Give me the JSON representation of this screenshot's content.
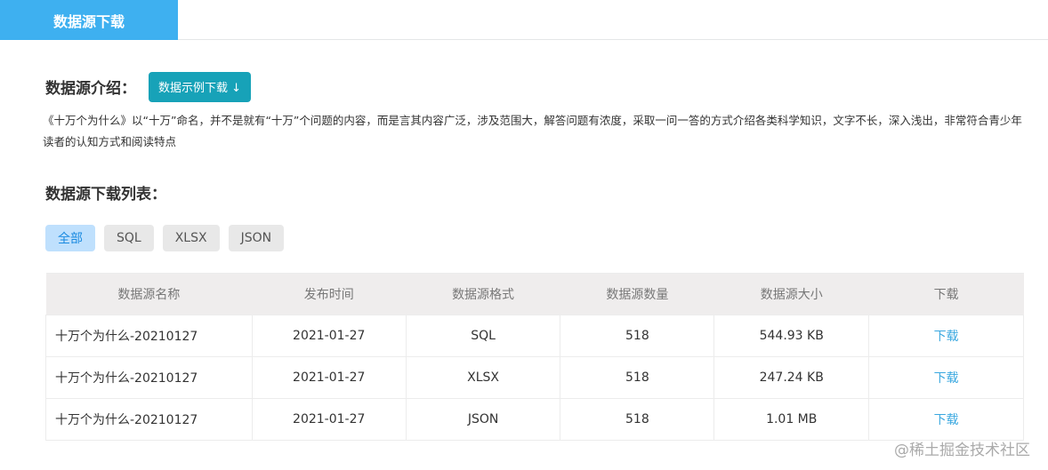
{
  "header": {
    "tab": "数据源下载"
  },
  "intro": {
    "title": "数据源介绍：",
    "download_sample": "数据示例下载 ↓",
    "description": "《十万个为什么》以“十万”命名，并不是就有“十万”个问题的内容，而是言其内容广泛，涉及范围大，解答问题有浓度，采取一问一答的方式介绍各类科学知识，文字不长，深入浅出，非常符合青少年读者的认知方式和阅读特点"
  },
  "list": {
    "title": "数据源下载列表：",
    "filters": [
      "全部",
      "SQL",
      "XLSX",
      "JSON"
    ],
    "columns": [
      "数据源名称",
      "发布时间",
      "数据源格式",
      "数据源数量",
      "数据源大小",
      "下载"
    ],
    "rows": [
      [
        "十万个为什么-20210127",
        "2021-01-27",
        "SQL",
        "518",
        "544.93 KB",
        "下载"
      ],
      [
        "十万个为什么-20210127",
        "2021-01-27",
        "XLSX",
        "518",
        "247.24 KB",
        "下载"
      ],
      [
        "十万个为什么-20210127",
        "2021-01-27",
        "JSON",
        "518",
        "1.01 MB",
        "下载"
      ]
    ]
  },
  "watermark": "@稀土掘金技术社区"
}
